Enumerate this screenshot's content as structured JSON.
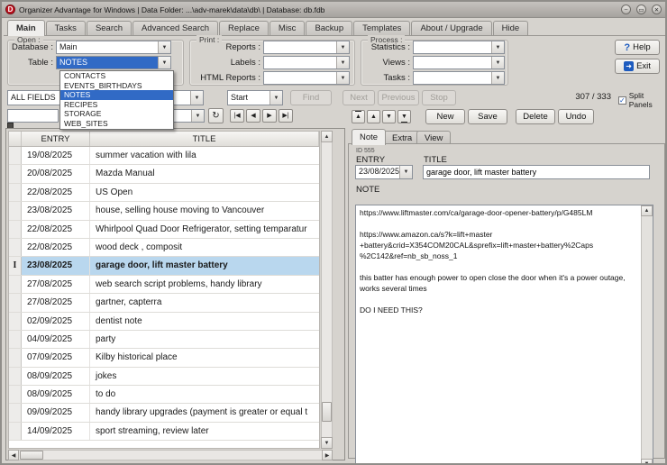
{
  "window": {
    "title": "Organizer Advantage for Windows | Data Folder: ...\\adv-marek\\data\\db\\ | Database: db.fdb",
    "icon_letter": "D",
    "minimize": "–",
    "maximize": "▭",
    "close": "✕"
  },
  "tabs": {
    "labels": [
      "Main",
      "Tasks",
      "Search",
      "Advanced Search",
      "Replace",
      "Misc",
      "Backup",
      "Templates",
      "About / Upgrade",
      "Hide"
    ],
    "active": "Main"
  },
  "toolbar": {
    "open": {
      "legend": "Open :",
      "database_label": "Database :",
      "database_value": "Main",
      "table_label": "Table :",
      "table_value": "NOTES"
    },
    "table_dropdown": {
      "options": [
        "CONTACTS",
        "EVENTS_BIRTHDAYS",
        "NOTES",
        "RECIPES",
        "STORAGE",
        "WEB_SITES"
      ],
      "selected": "NOTES"
    },
    "print": {
      "legend": "Print :",
      "reports_label": "Reports :",
      "labels_label": "Labels :",
      "html_reports_label": "HTML Reports :"
    },
    "process": {
      "legend": "Process :",
      "statistics_label": "Statistics :",
      "views_label": "Views :",
      "tasks_label": "Tasks :"
    },
    "help_label": "Help",
    "exit_label": "Exit"
  },
  "search": {
    "field_selector": "ALL FIELDS",
    "match_selector": "Start",
    "find_label": "Find",
    "next_label": "Next",
    "previous_label": "Previous",
    "stop_label": "Stop",
    "counter": "307 / 333",
    "split_panels_label": "Split Panels",
    "split_panels_checked": "✓"
  },
  "record_bar": {
    "new_label": "New",
    "save_label": "Save",
    "delete_label": "Delete",
    "undo_label": "Undo"
  },
  "grid": {
    "columns": {
      "entry": "ENTRY",
      "title": "TITLE"
    },
    "rows": [
      {
        "entry": "19/08/2025",
        "title": "summer vacation with lila"
      },
      {
        "entry": "20/08/2025",
        "title": "Mazda Manual"
      },
      {
        "entry": "22/08/2025",
        "title": "US Open"
      },
      {
        "entry": "23/08/2025",
        "title": "house, selling house moving to Vancouver"
      },
      {
        "entry": "22/08/2025",
        "title": "Whirlpool Quad Door Refrigerator, setting temparatur"
      },
      {
        "entry": "22/08/2025",
        "title": "wood deck , composit"
      },
      {
        "entry": "23/08/2025",
        "title": "garage door, lift master battery",
        "selected": true,
        "indicator": "I"
      },
      {
        "entry": "27/08/2025",
        "title": "web search script problems, handy library"
      },
      {
        "entry": "27/08/2025",
        "title": "gartner, capterra"
      },
      {
        "entry": "02/09/2025",
        "title": "dentist note"
      },
      {
        "entry": "04/09/2025",
        "title": "party"
      },
      {
        "entry": "07/09/2025",
        "title": "Kilby historical place"
      },
      {
        "entry": "08/09/2025",
        "title": "jokes"
      },
      {
        "entry": "08/09/2025",
        "title": "to do"
      },
      {
        "entry": "09/09/2025",
        "title": "handy library upgrades (payment is greater or equal t"
      },
      {
        "entry": "14/09/2025",
        "title": "sport streaming, review later"
      }
    ]
  },
  "detail": {
    "tabs": [
      "Note",
      "Extra",
      "View"
    ],
    "active_tab": "Note",
    "record_id": "ID 555",
    "entry_label": "ENTRY",
    "entry_value": "23/08/2025",
    "title_label": "TITLE",
    "title_value": "garage door, lift master battery",
    "note_label": "NOTE",
    "note_text": "https://www.liftmaster.com/ca/garage-door-opener-battery/p/G485LM\n\nhttps://www.amazon.ca/s?k=lift+master\n+battery&crid=X354COM20CAL&sprefix=lift+master+battery%2Caps\n%2C142&ref=nb_sb_noss_1\n\nthis batter has enough power to open close the door when it's a power outage,\nworks several times\n\nDO I NEED THIS?"
  }
}
